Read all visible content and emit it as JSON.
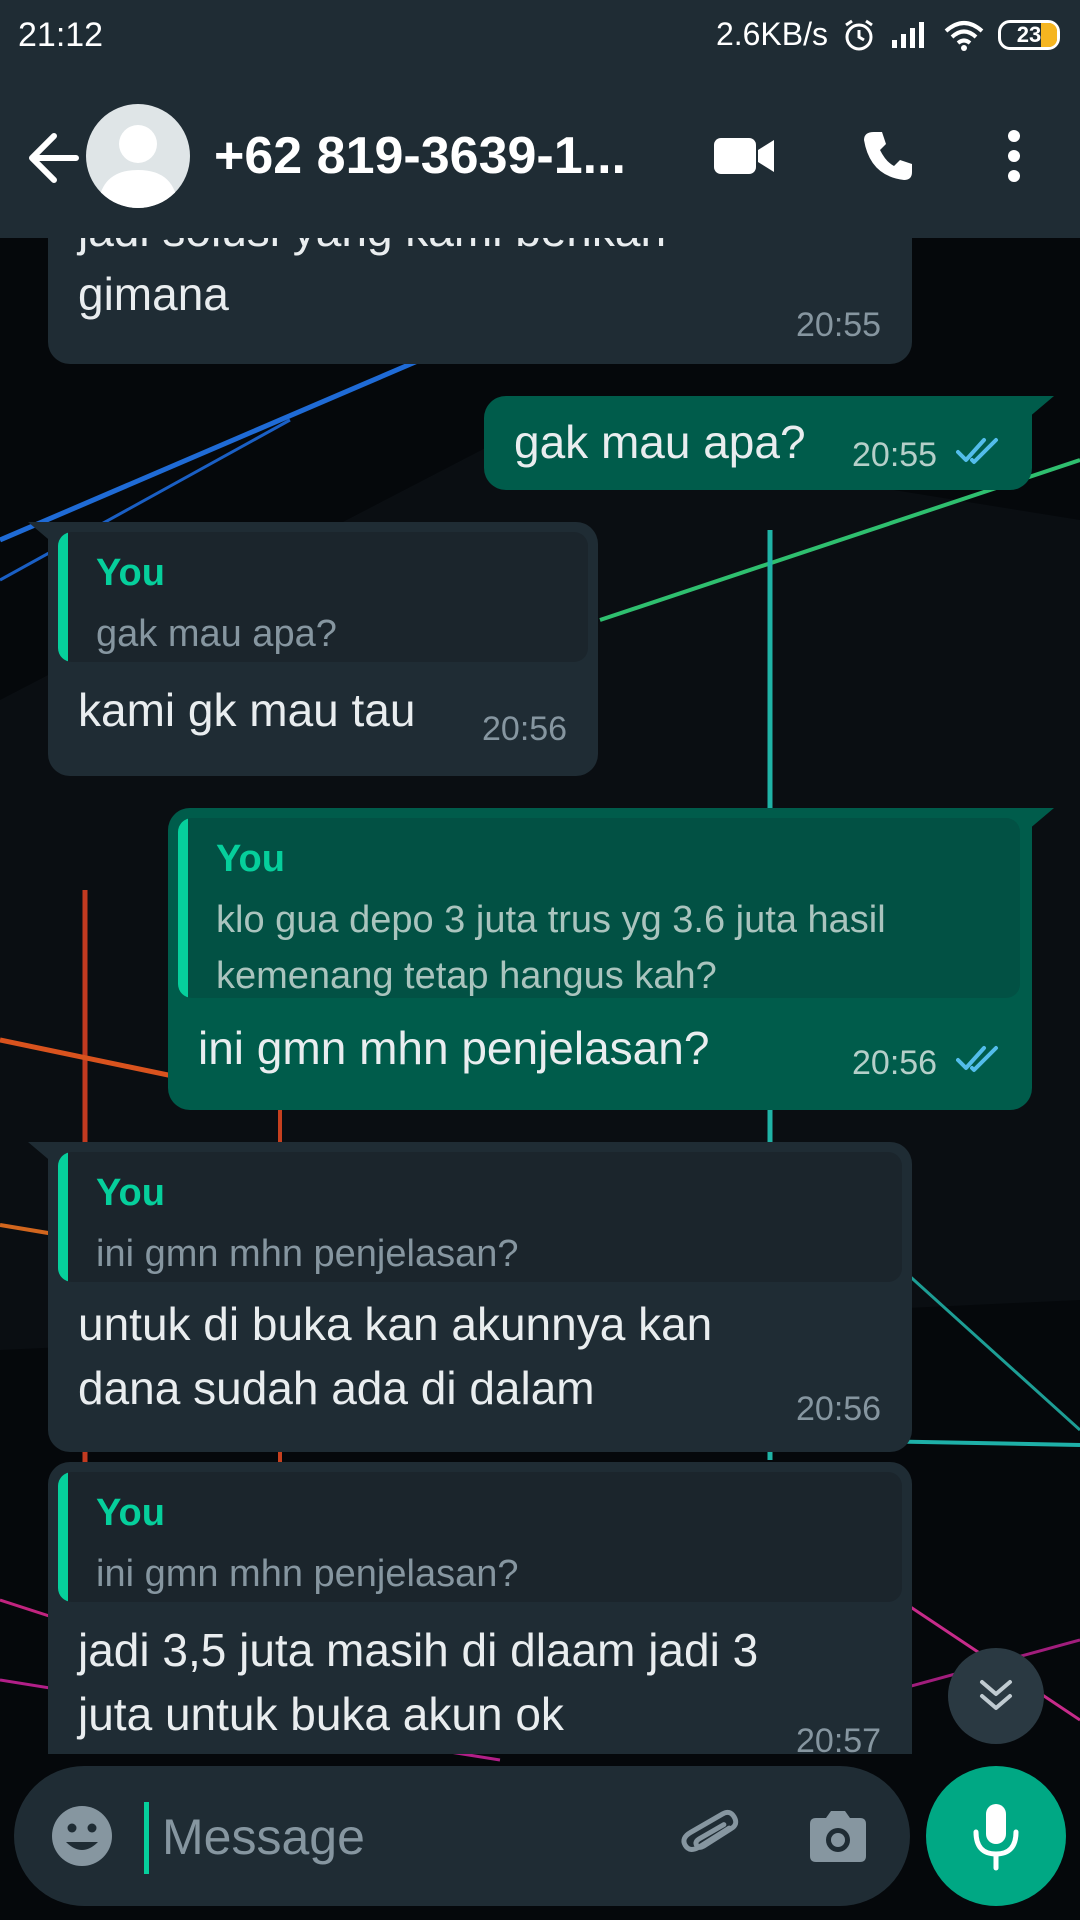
{
  "status_bar": {
    "time": "21:12",
    "speed": "2.6KB/s",
    "battery": "23"
  },
  "header": {
    "contact": "+62 819-3639-1...",
    "icons": [
      "back-arrow-icon",
      "avatar",
      "video-call-icon",
      "voice-call-icon",
      "more-options-icon"
    ]
  },
  "messages": [
    {
      "dir": "in",
      "text_lines": [
        "jadi solusi yang kami berikan",
        "gimana"
      ],
      "time": "20:55"
    },
    {
      "dir": "out",
      "text": "gak mau apa?",
      "time": "20:55",
      "read": true
    },
    {
      "dir": "in",
      "quote": {
        "author": "You",
        "text": "gak mau apa?"
      },
      "text": "kami gk mau tau",
      "time": "20:56"
    },
    {
      "dir": "out",
      "quote": {
        "author": "You",
        "text_lines": [
          "klo gua depo 3 juta trus yg 3.6 juta hasil",
          "kemenang tetap hangus kah?"
        ]
      },
      "text": "ini gmn mhn penjelasan?",
      "time": "20:56",
      "read": true
    },
    {
      "dir": "in",
      "quote": {
        "author": "You",
        "text": "ini gmn mhn penjelasan?"
      },
      "text_lines": [
        "untuk di buka kan akunnya kan",
        "dana sudah ada di dalam"
      ],
      "time": "20:56"
    },
    {
      "dir": "in",
      "quote": {
        "author": "You",
        "text": "ini gmn mhn penjelasan?"
      },
      "text_lines": [
        "jadi 3,5 juta masih di dlaam jadi 3",
        "juta untuk buka akun ok"
      ],
      "time": "20:57"
    }
  ],
  "composer": {
    "placeholder": "Message"
  },
  "colors": {
    "header_bg": "#1f2c34",
    "incoming_bubble": "#1f2c34",
    "outgoing_bubble": "#005c4b",
    "accent": "#00a884",
    "read_ticks": "#53bdeb"
  }
}
